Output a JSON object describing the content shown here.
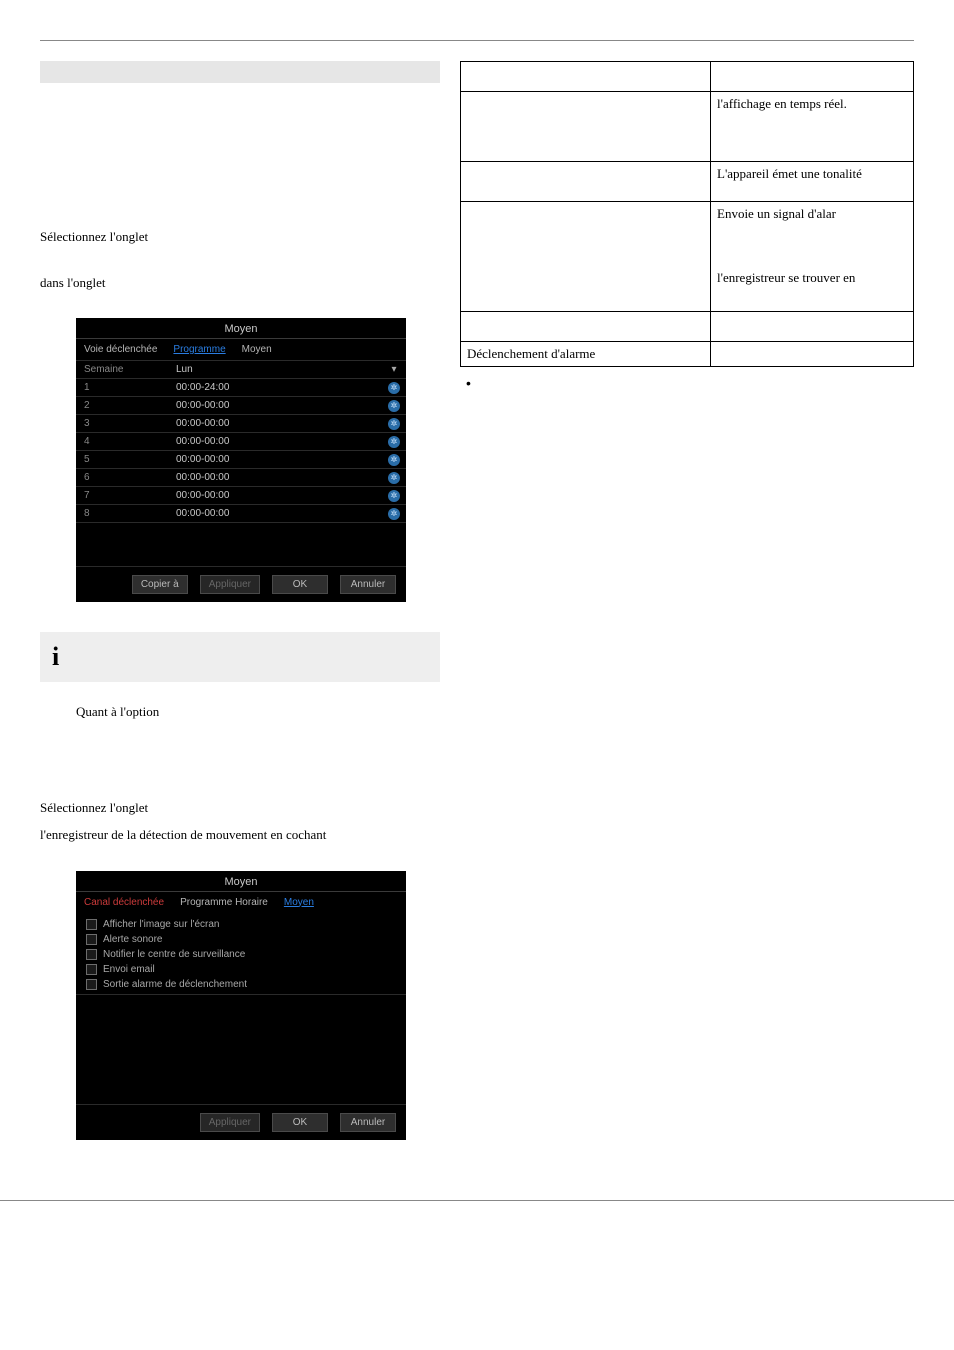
{
  "text": {
    "select_tab_1": "Sélectionnez l'onglet",
    "in_tab": "dans l'onglet",
    "when_option": "Quant à l'option",
    "select_tab_2": "Sélectionnez l'onglet",
    "rec_motion_desc": "l'enregistreur de la détection de mouvement en cochant"
  },
  "ui1": {
    "title": "Moyen",
    "tab_channel": "Voie déclenchée",
    "tab_schedule": "Programme",
    "tab_method": "Moyen",
    "hdr_week": "Semaine",
    "hdr_day": "Lun",
    "rows": [
      {
        "n": "1",
        "t": "00:00-24:00"
      },
      {
        "n": "2",
        "t": "00:00-00:00"
      },
      {
        "n": "3",
        "t": "00:00-00:00"
      },
      {
        "n": "4",
        "t": "00:00-00:00"
      },
      {
        "n": "5",
        "t": "00:00-00:00"
      },
      {
        "n": "6",
        "t": "00:00-00:00"
      },
      {
        "n": "7",
        "t": "00:00-00:00"
      },
      {
        "n": "8",
        "t": "00:00-00:00"
      }
    ],
    "btn_copy": "Copier à",
    "btn_apply": "Appliquer",
    "btn_ok": "OK",
    "btn_cancel": "Annuler"
  },
  "ui2": {
    "title": "Moyen",
    "tab_channel": "Canal déclenchée",
    "tab_schedule": "Programme Horaire",
    "tab_method": "Moyen",
    "checks": {
      "c1": "Afficher l'image sur l'écran",
      "c2": "Alerte sonore",
      "c3": "Notifier le centre de surveillance",
      "c4": "Envoi email",
      "c5": "Sortie alarme de déclenchement"
    },
    "btn_apply": "Appliquer",
    "btn_ok": "OK",
    "btn_cancel": "Annuler"
  },
  "info": {
    "symbol": "i"
  },
  "rtab": {
    "r1": "l'affichage en temps réel.",
    "r2": "L'appareil émet une tonalité",
    "r3": "Envoie un signal d'alar",
    "r4": "l'enregistreur se trouver en",
    "left5": "Déclenchement d'alarme"
  },
  "bullet": "•"
}
